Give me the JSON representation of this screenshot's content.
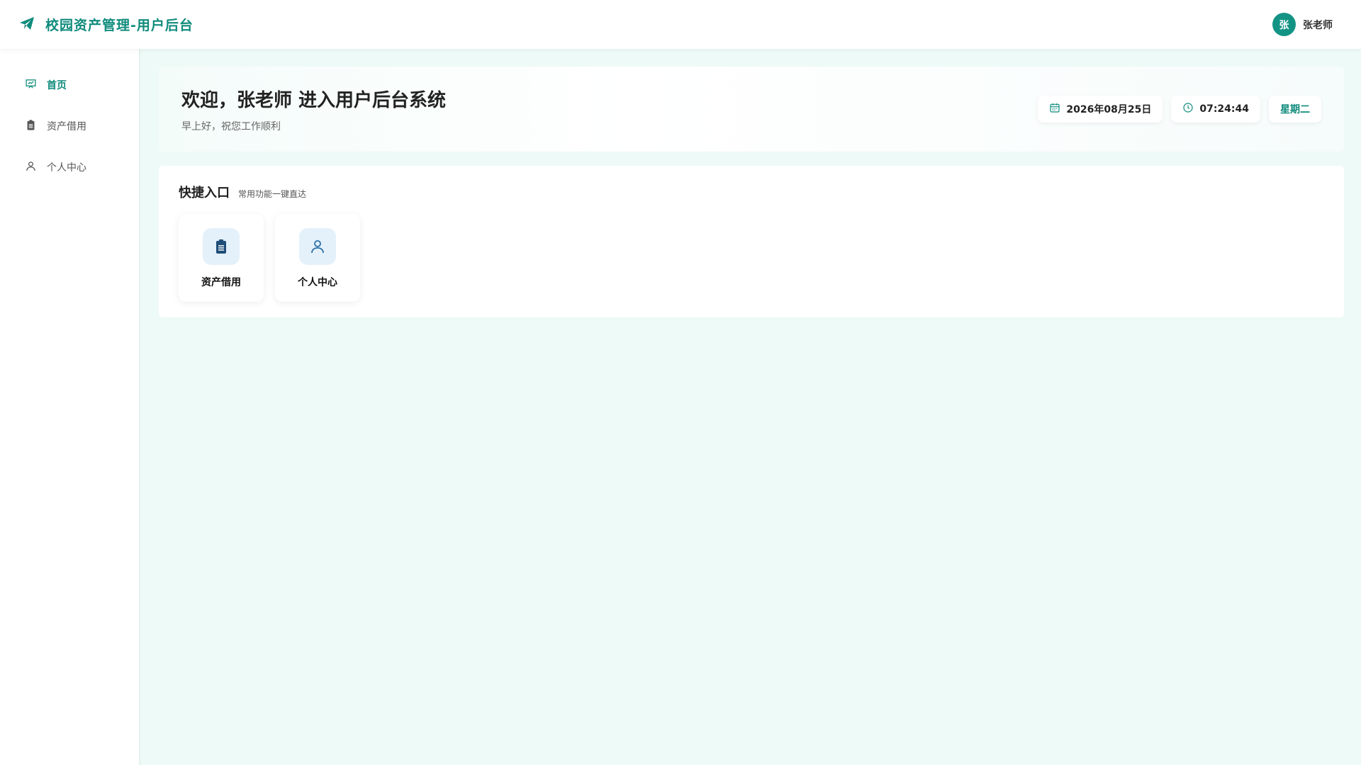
{
  "header": {
    "title": "校园资产管理-用户后台",
    "brand_icon": "paper-plane-icon",
    "avatar_text": "张",
    "user_name": "张老师"
  },
  "sidebar": {
    "items": [
      {
        "label": "首页",
        "icon": "presentation-icon",
        "active": true
      },
      {
        "label": "资产借用",
        "icon": "clipboard-icon",
        "active": false
      },
      {
        "label": "个人中心",
        "icon": "user-icon",
        "active": false
      }
    ]
  },
  "welcome": {
    "title": "欢迎，张老师 进入用户后台系统",
    "subtitle": "早上好，祝您工作顺利",
    "date": "2026年08月25日",
    "time": "07:24:44",
    "weekday": "星期二"
  },
  "quick": {
    "title": "快捷入口",
    "subtitle": "常用功能一键直达",
    "cards": [
      {
        "label": "资产借用",
        "icon": "clipboard-icon"
      },
      {
        "label": "个人中心",
        "icon": "user-icon"
      }
    ]
  },
  "colors": {
    "accent": "#0f8b7c",
    "background": "#eefaf7",
    "quick_icon_bg": "#e4f1fb"
  }
}
